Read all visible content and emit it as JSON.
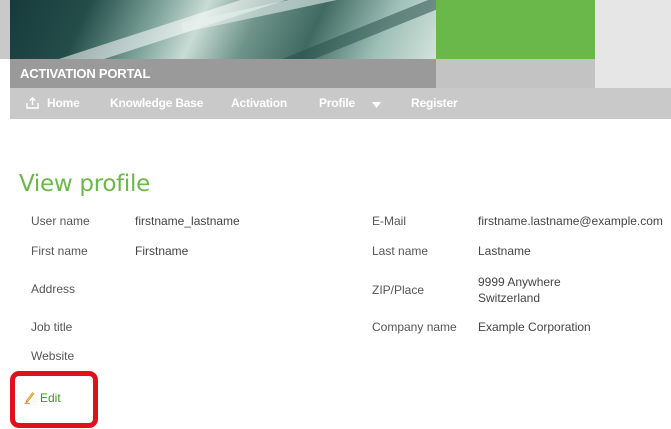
{
  "header": {
    "portal_title": "ACTIVATION PORTAL"
  },
  "nav": {
    "home": "Home",
    "knowledge_base": "Knowledge Base",
    "activation": "Activation",
    "profile": "Profile",
    "register": "Register"
  },
  "page": {
    "title": "View profile"
  },
  "profile": {
    "username_label": "User name",
    "username_value": "firstname_lastname",
    "email_label": "E-Mail",
    "email_value": "firstname.lastname@example.com",
    "firstname_label": "First name",
    "firstname_value": "Firstname",
    "lastname_label": "Last name",
    "lastname_value": "Lastname",
    "address_label": "Address",
    "zip_label": "ZIP/Place",
    "zip_line1": "9999 Anywhere",
    "zip_line2": "Switzerland",
    "jobtitle_label": "Job title",
    "company_label": "Company name",
    "company_value": "Example Corporation",
    "website_label": "Website"
  },
  "actions": {
    "edit_label": "Edit"
  },
  "colors": {
    "accent_green": "#6ab84a",
    "highlight_red": "#e0111a"
  },
  "icons": {
    "home": "home-icon",
    "dropdown": "caret-down-icon",
    "edit": "pencil-icon"
  }
}
